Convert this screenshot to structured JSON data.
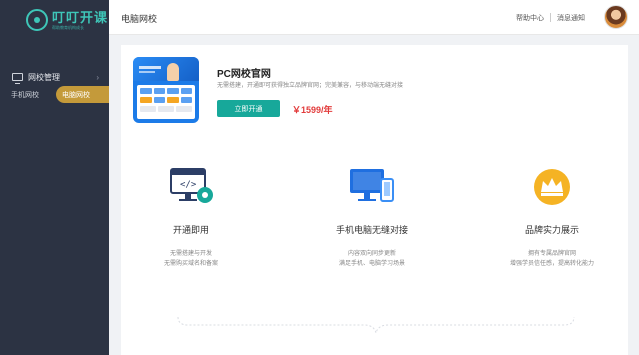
{
  "sidebar": {
    "logo": {
      "name": "叮叮开课",
      "subtitle": "帮助教育机构成长"
    },
    "group": {
      "label": "网校管理",
      "icon": "monitor-icon"
    },
    "items": [
      {
        "label": "手机网校",
        "active": false
      },
      {
        "label": "电脑网校",
        "active": true
      }
    ]
  },
  "header": {
    "title": "电脑网校",
    "help": "帮助中心",
    "messages": "消息通知"
  },
  "product": {
    "title": "PC网校官网",
    "description": "无需搭建，开通即可获得独立品牌官网；完美兼容，与移动端无缝对接",
    "button": "立即开通",
    "price": "￥1599/年"
  },
  "features": [
    {
      "icon": "code-settings-icon",
      "title": "开通即用",
      "lines": [
        "无需搭建与开发",
        "无需购买域名和备案"
      ]
    },
    {
      "icon": "devices-icon",
      "title": "手机电脑无缝对接",
      "lines": [
        "内容双向同步更新",
        "满足手机、电脑学习场景"
      ]
    },
    {
      "icon": "crown-icon",
      "title": "品牌实力展示",
      "lines": [
        "拥有专属品牌官网",
        "增强学员信任感，提高转化能力"
      ]
    }
  ],
  "colors": {
    "sidebar": "#2c3343",
    "accent": "#17a89a",
    "active": "#c49a3a",
    "price": "#e23b3b"
  }
}
